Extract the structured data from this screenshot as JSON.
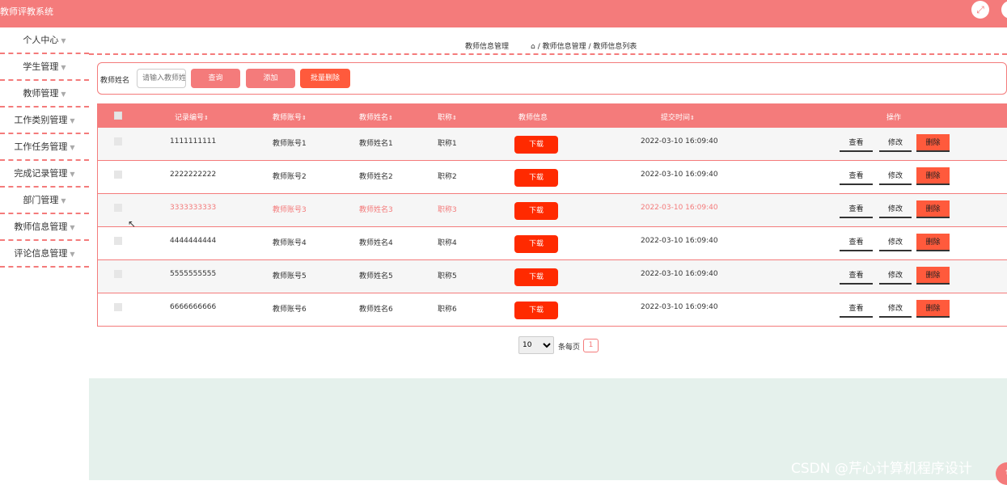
{
  "app": {
    "title": "教师评教系统"
  },
  "sidebar": {
    "items": [
      {
        "label": "个人中心"
      },
      {
        "label": "学生管理"
      },
      {
        "label": "教师管理"
      },
      {
        "label": "工作类别管理"
      },
      {
        "label": "工作任务管理"
      },
      {
        "label": "完成记录管理"
      },
      {
        "label": "部门管理"
      },
      {
        "label": "教师信息管理"
      },
      {
        "label": "评论信息管理"
      }
    ]
  },
  "breadcrumb": {
    "title": "教师信息管理",
    "path": "/ 教师信息管理 / 教师信息列表"
  },
  "search": {
    "label": "教师姓名",
    "placeholder": "请输入教师姓名",
    "query_button": "查询",
    "add_button": "添加",
    "batch_delete_button": "批量删除"
  },
  "table": {
    "headers": {
      "record_no": "记录编号",
      "account": "教师账号",
      "name": "教师姓名",
      "title": "职称",
      "info": "教师信息",
      "submit_time": "提交时间",
      "actions": "操作"
    },
    "sort_icon": "⇕",
    "rows": [
      {
        "record_no": "1111111111",
        "account": "教师账号1",
        "name": "教师姓名1",
        "title": "职称1",
        "download": "下载",
        "submit_time": "2022-03-10 16:09:40",
        "view": "查看",
        "edit": "修改",
        "delete": "删除"
      },
      {
        "record_no": "2222222222",
        "account": "教师账号2",
        "name": "教师姓名2",
        "title": "职称2",
        "download": "下载",
        "submit_time": "2022-03-10 16:09:40",
        "view": "查看",
        "edit": "修改",
        "delete": "删除"
      },
      {
        "record_no": "3333333333",
        "account": "教师账号3",
        "name": "教师姓名3",
        "title": "职称3",
        "download": "下载",
        "submit_time": "2022-03-10 16:09:40",
        "view": "查看",
        "edit": "修改",
        "delete": "删除"
      },
      {
        "record_no": "4444444444",
        "account": "教师账号4",
        "name": "教师姓名4",
        "title": "职称4",
        "download": "下载",
        "submit_time": "2022-03-10 16:09:40",
        "view": "查看",
        "edit": "修改",
        "delete": "删除"
      },
      {
        "record_no": "5555555555",
        "account": "教师账号5",
        "name": "教师姓名5",
        "title": "职称5",
        "download": "下载",
        "submit_time": "2022-03-10 16:09:40",
        "view": "查看",
        "edit": "修改",
        "delete": "删除"
      },
      {
        "record_no": "6666666666",
        "account": "教师账号6",
        "name": "教师姓名6",
        "title": "职称6",
        "download": "下载",
        "submit_time": "2022-03-10 16:09:40",
        "view": "查看",
        "edit": "修改",
        "delete": "删除"
      }
    ]
  },
  "pagination": {
    "page_size": "10",
    "per_page_label": "条每页",
    "current_page": "1"
  },
  "watermark": "CSDN @芹心计算机程序设计",
  "icons": {
    "fullscreen": "fullscreen-icon",
    "close": "close-icon",
    "home": "home-icon",
    "caret": "caret-down-icon"
  },
  "colors": {
    "primary": "#f47b7b",
    "download": "#ff2a00",
    "danger": "#ff5a3c",
    "panel": "#e5f1ec"
  }
}
